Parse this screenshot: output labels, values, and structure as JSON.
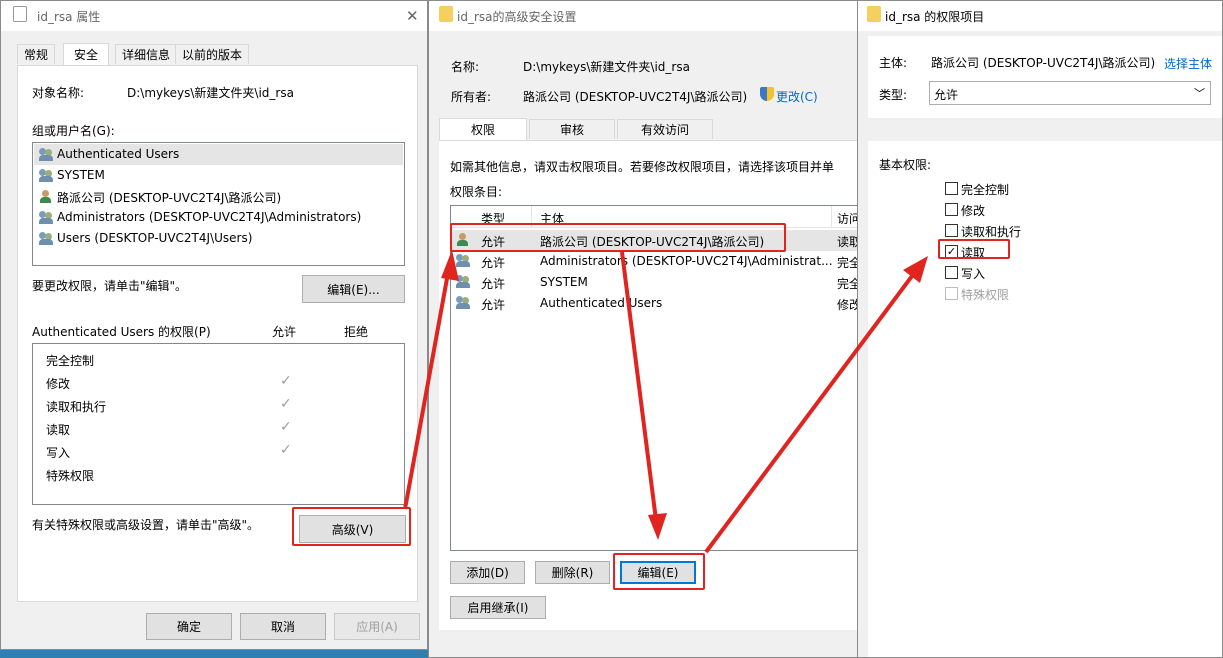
{
  "win1": {
    "title": "id_rsa 属性",
    "close": "✕",
    "tabs": [
      "常规",
      "安全",
      "详细信息",
      "以前的版本"
    ],
    "object_label": "对象名称:",
    "object_value": "D:\\mykeys\\新建文件夹\\id_rsa",
    "group_label": "组或用户名(G):",
    "users": [
      "Authenticated Users",
      "SYSTEM",
      "路派公司 (DESKTOP-UVC2T4J\\路派公司)",
      "Administrators (DESKTOP-UVC2T4J\\Administrators)",
      "Users (DESKTOP-UVC2T4J\\Users)"
    ],
    "change_hint": "要更改权限，请单击\"编辑\"。",
    "edit_button": "编辑(E)...",
    "perm_header": "Authenticated Users 的权限(P)",
    "allow_header": "允许",
    "deny_header": "拒绝",
    "perms": [
      "完全控制",
      "修改",
      "读取和执行",
      "读取",
      "写入",
      "特殊权限"
    ],
    "advanced_hint": "有关特殊权限或高级设置，请单击\"高级\"。",
    "advanced_button": "高级(V)",
    "ok_button": "确定",
    "cancel_button": "取消",
    "apply_button": "应用(A)"
  },
  "win2": {
    "title": "id_rsa的高级安全设置",
    "name_label": "名称:",
    "name_value": "D:\\mykeys\\新建文件夹\\id_rsa",
    "owner_label": "所有者:",
    "owner_value": "路派公司 (DESKTOP-UVC2T4J\\路派公司)",
    "change_link": "更改(C)",
    "tabs": [
      "权限",
      "审核",
      "有效访问"
    ],
    "info_text": "如需其他信息，请双击权限项目。若要修改权限项目，请选择该项目并单",
    "entries_label": "权限条目:",
    "columns": [
      "类型",
      "主体",
      "访问"
    ],
    "rows": [
      {
        "type": "允许",
        "principal": "路派公司 (DESKTOP-UVC2T4J\\路派公司)",
        "access": "读取"
      },
      {
        "type": "允许",
        "principal": "Administrators (DESKTOP-UVC2T4J\\Administrat...",
        "access": "完全"
      },
      {
        "type": "允许",
        "principal": "SYSTEM",
        "access": "完全"
      },
      {
        "type": "允许",
        "principal": "Authenticated Users",
        "access": "修改"
      }
    ],
    "add_button": "添加(D)",
    "remove_button": "删除(R)",
    "edit_button": "编辑(E)",
    "inherit_button": "启用继承(I)"
  },
  "win3": {
    "title": "id_rsa 的权限项目",
    "principal_label": "主体:",
    "principal_value": "路派公司 (DESKTOP-UVC2T4J\\路派公司)",
    "select_link": "选择主体",
    "type_label": "类型:",
    "type_value": "允许",
    "basic_label": "基本权限:",
    "perms": [
      {
        "label": "完全控制",
        "checked": false,
        "enabled": true
      },
      {
        "label": "修改",
        "checked": false,
        "enabled": true
      },
      {
        "label": "读取和执行",
        "checked": false,
        "enabled": true
      },
      {
        "label": "读取",
        "checked": true,
        "enabled": true
      },
      {
        "label": "写入",
        "checked": false,
        "enabled": true
      },
      {
        "label": "特殊权限",
        "checked": false,
        "enabled": false
      }
    ]
  },
  "colors": {
    "annotation_red": "#e0241f",
    "link_blue": "#0066cc",
    "selection_bg": "#e5e5e5",
    "desktop_bg": "#2f7fb0"
  }
}
